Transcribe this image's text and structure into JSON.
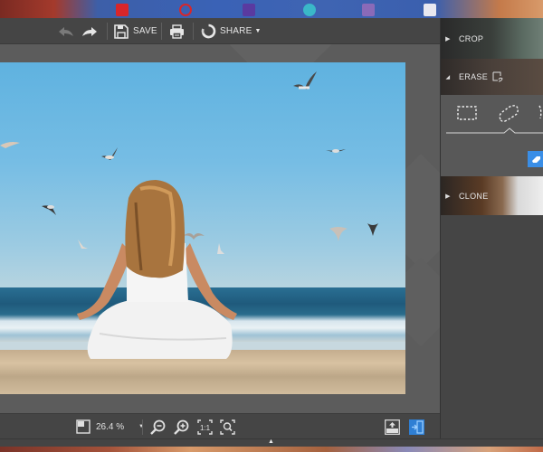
{
  "toolbar": {
    "undo_icon": "undo-arrow-icon",
    "redo_icon": "redo-arrow-icon",
    "save_label": "SAVE",
    "print_icon": "printer-icon",
    "share_label": "SHARE",
    "share_dropdown_icon": "caret-down-icon"
  },
  "panel": {
    "sections": [
      {
        "label": "CROP",
        "state": "collapsed"
      },
      {
        "label": "ERASE",
        "state": "expanded"
      },
      {
        "label": "CLONE",
        "state": "collapsed"
      }
    ],
    "erase_tools": [
      "rectangle-select",
      "lasso-select",
      "brush-select"
    ],
    "erase_selected_tool": "lasso-select",
    "erase_action_icon": "eraser-icon"
  },
  "statusbar": {
    "zoom_value": "26.4 %",
    "zoom_dropdown_icon": "caret-down-icon",
    "buttons": [
      "zoom-out",
      "zoom-in",
      "actual-size-1-1",
      "fit-to-screen"
    ],
    "right_buttons": [
      "export-image",
      "toggle-panel"
    ]
  },
  "colors": {
    "accent": "#3a8ee6",
    "toolbar_bg": "#454545",
    "canvas_bg": "#5c5c5c",
    "panel_bg": "#444444"
  }
}
